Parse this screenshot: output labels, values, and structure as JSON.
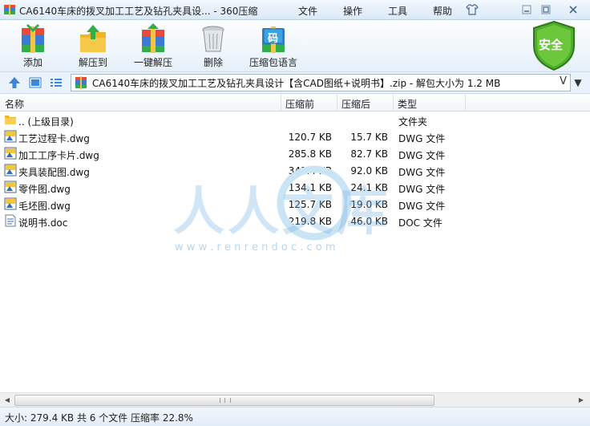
{
  "window": {
    "title": "CA6140车床的拨叉加工工艺及钻孔夹具设... - 360压缩",
    "menu": [
      "文件",
      "操作",
      "工具",
      "帮助"
    ]
  },
  "toolbar": {
    "buttons": [
      {
        "label": "添加",
        "icon": "add-archive-icon"
      },
      {
        "label": "解压到",
        "icon": "extract-to-icon"
      },
      {
        "label": "一键解压",
        "icon": "one-click-extract-icon"
      },
      {
        "label": "删除",
        "icon": "delete-bin-icon"
      },
      {
        "label": "压缩包语言",
        "icon": "archive-language-icon"
      }
    ],
    "security_badge": "安全",
    "language_badge_char": "码"
  },
  "address": {
    "path": "CA6140车床的拨叉加工工艺及钻孔夹具设计【含CAD图纸+说明书】.zip - 解包大小为 1.2 MB",
    "dropdown_glyph": "V"
  },
  "columns": {
    "name": "名称",
    "compressed_before": "压缩前",
    "compressed_after": "压缩后",
    "type": "类型"
  },
  "files": [
    {
      "name": ".. (上级目录)",
      "before": "",
      "after": "",
      "type": "文件夹",
      "icon": "folder-icon"
    },
    {
      "name": "工艺过程卡.dwg",
      "before": "120.7 KB",
      "after": "15.7 KB",
      "type": "DWG 文件",
      "icon": "dwg-file-icon"
    },
    {
      "name": "加工工序卡片.dwg",
      "before": "285.8 KB",
      "after": "82.7 KB",
      "type": "DWG 文件",
      "icon": "dwg-file-icon"
    },
    {
      "name": "夹具装配图.dwg",
      "before": "341.4 KB",
      "after": "92.0 KB",
      "type": "DWG 文件",
      "icon": "dwg-file-icon"
    },
    {
      "name": "零件图.dwg",
      "before": "134.1 KB",
      "after": "24.1 KB",
      "type": "DWG 文件",
      "icon": "dwg-file-icon"
    },
    {
      "name": "毛坯图.dwg",
      "before": "125.7 KB",
      "after": "19.0 KB",
      "type": "DWG 文件",
      "icon": "dwg-file-icon"
    },
    {
      "name": "说明书.doc",
      "before": "219.8 KB",
      "after": "46.0 KB",
      "type": "DOC 文件",
      "icon": "doc-file-icon"
    }
  ],
  "watermark": {
    "chars": "人人文库",
    "url": "w w w . r e n r e n d o c . c o m"
  },
  "status": {
    "text": "大小: 279.4 KB 共 6 个文件 压缩率 22.8%"
  }
}
